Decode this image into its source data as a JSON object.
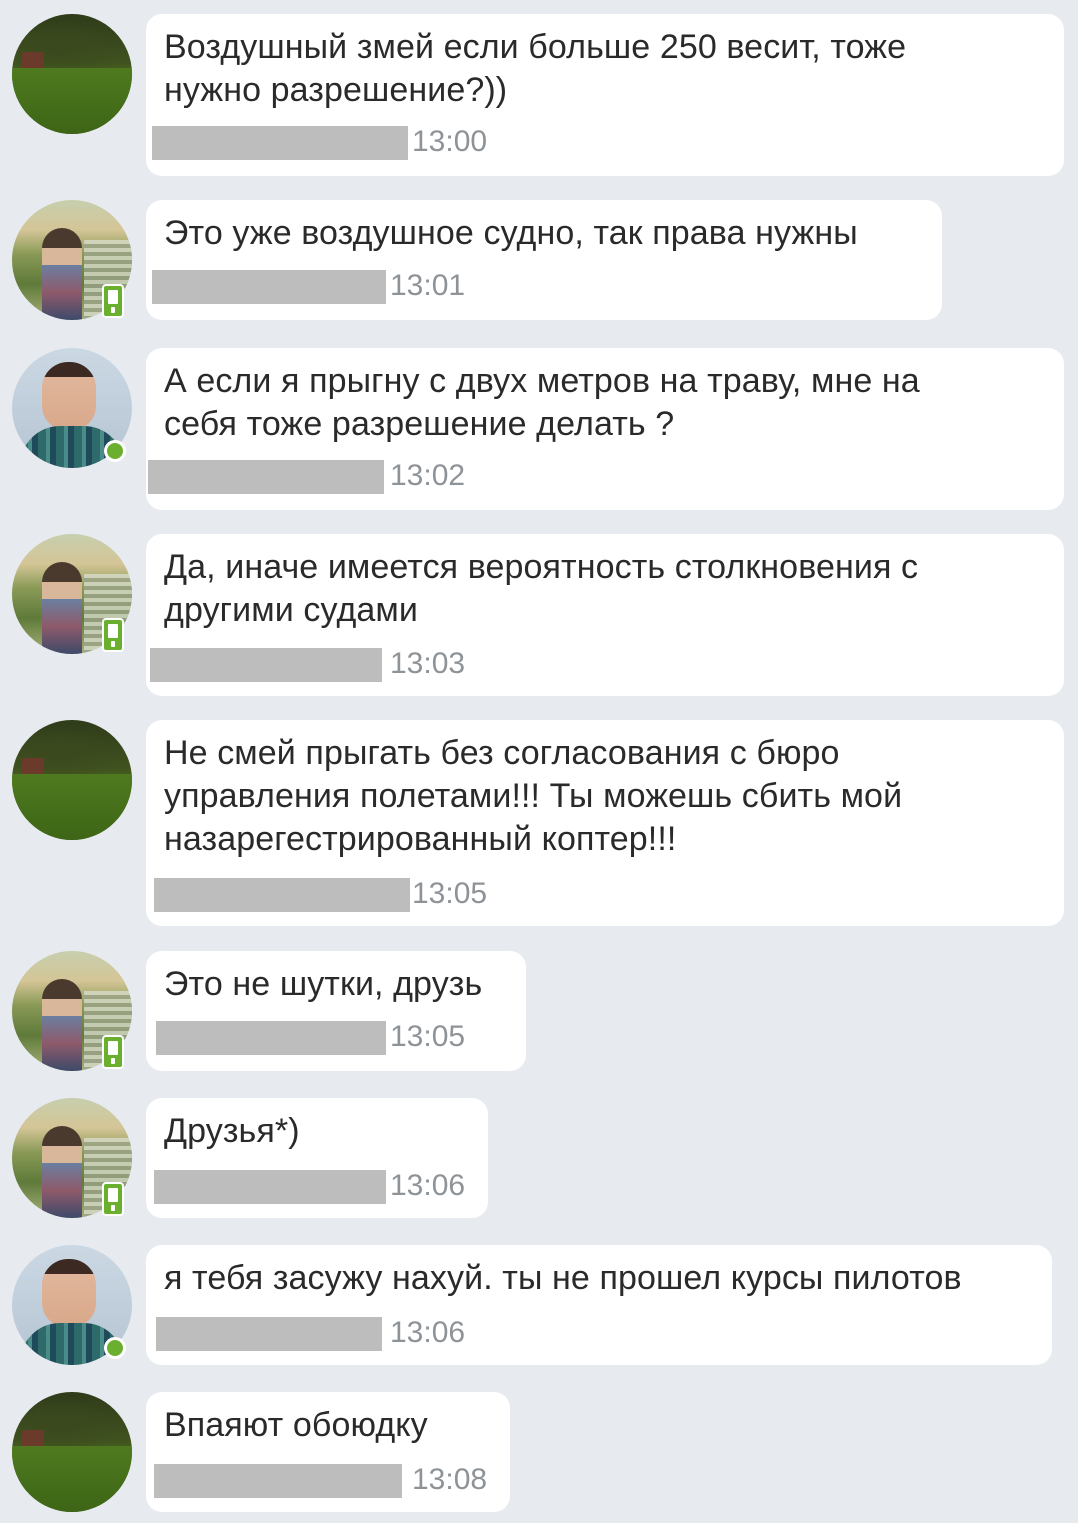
{
  "messages": [
    {
      "avatar": "grass",
      "badge": "none",
      "text": "Воздушный змей если больше 250 весит, тоже\nнужно разрешение?))",
      "time": "13:00"
    },
    {
      "avatar": "palace",
      "badge": "mobile",
      "text": "Это уже воздушное судно, так права нужны",
      "time": "13:01"
    },
    {
      "avatar": "guy",
      "badge": "online",
      "text": "А если я прыгну с двух метров на траву, мне на\nсебя тоже разрешение делать ?",
      "time": "13:02"
    },
    {
      "avatar": "palace",
      "badge": "mobile",
      "text": "Да, иначе имеется вероятность столкновения с\nдругими судами",
      "time": "13:03"
    },
    {
      "avatar": "grass",
      "badge": "none",
      "text": "Не смей прыгать без согласования с бюро\nуправления полетами!!! Ты можешь сбить мой\nназарегестрированный коптер!!!",
      "time": "13:05"
    },
    {
      "avatar": "palace",
      "badge": "mobile",
      "text": "Это не шутки, друзь",
      "time": "13:05"
    },
    {
      "avatar": "palace",
      "badge": "mobile",
      "text": "Друзья*)",
      "time": "13:06"
    },
    {
      "avatar": "guy",
      "badge": "online",
      "text": "я тебя засужу нахуй. ты не прошел курсы пилотов",
      "time": "13:06"
    },
    {
      "avatar": "grass",
      "badge": "none",
      "text": "Впаяют обоюдку",
      "time": "13:08"
    }
  ],
  "colors": {
    "background": "#e7ebf0",
    "bubble": "#ffffff",
    "text": "#2a2a2a",
    "time": "#8e9398",
    "redaction": "#bdbdbd",
    "online": "#6ab02e"
  }
}
